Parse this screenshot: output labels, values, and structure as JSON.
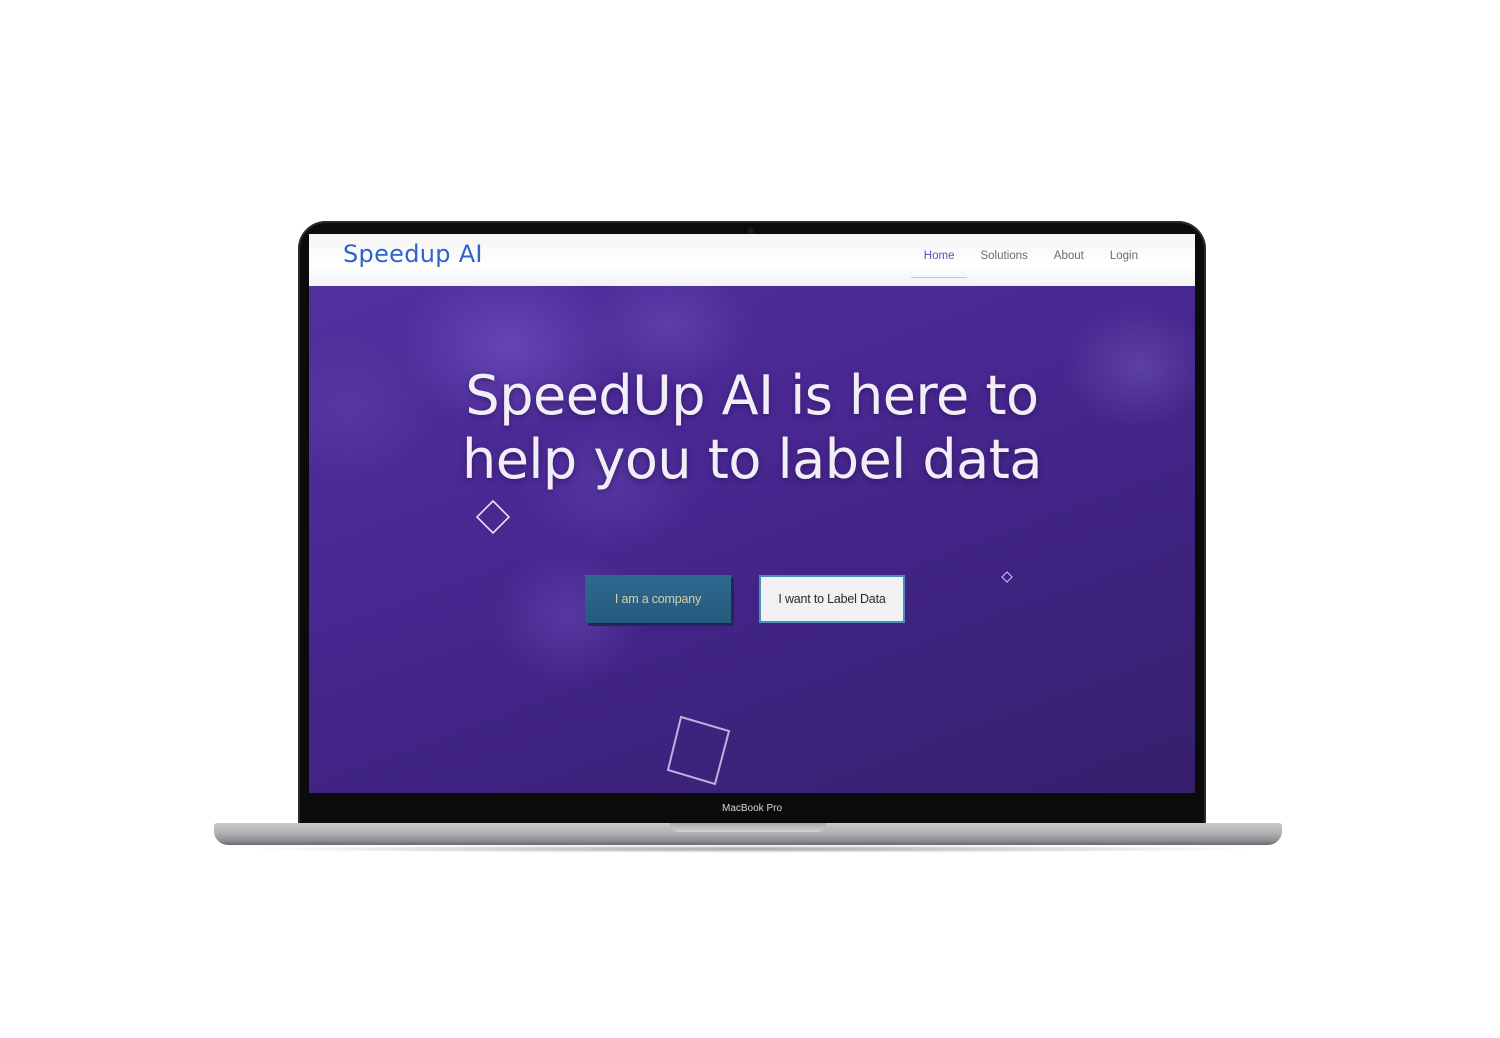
{
  "device": {
    "model_label": "MacBook Pro"
  },
  "navbar": {
    "brand": "Speedup AI",
    "links": [
      {
        "label": "Home",
        "active": true
      },
      {
        "label": "Solutions",
        "active": false
      },
      {
        "label": "About",
        "active": false
      },
      {
        "label": "Login",
        "active": false
      }
    ]
  },
  "hero": {
    "headline_line1": "SpeedUp AI is here to",
    "headline_line2": "help you to label data",
    "company_button": "I am a company",
    "label_button": "I want to Label Data"
  },
  "colors": {
    "brand": "#2e63c9",
    "hero_background": "#4a2893",
    "company_button": "#2a5f86",
    "label_button_border": "#4a8fb8"
  }
}
